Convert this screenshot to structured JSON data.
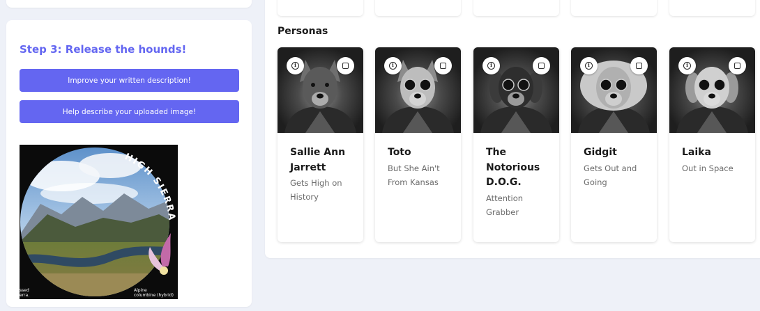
{
  "step": {
    "title": "Step 3: Release the hounds!",
    "buttons": [
      {
        "label": "Improve your written description!"
      },
      {
        "label": "Help describe your uploaded image!"
      }
    ]
  },
  "poster": {
    "arc_text": "HIGH SIERRA",
    "caption_left": "ssed\nerra.",
    "caption_right": "Alpine\ncolumbine (hybrid)"
  },
  "personas": {
    "title": "Personas",
    "cards": [
      {
        "name": "Sallie Ann Jarrett",
        "desc": "Gets High on History"
      },
      {
        "name": "Toto",
        "desc": "But She Ain't From Kansas"
      },
      {
        "name": "The Notorious D.O.G.",
        "desc": "Attention Grabber"
      },
      {
        "name": "Gidgit",
        "desc": "Gets Out and Going"
      },
      {
        "name": "Laika",
        "desc": "Out in Space"
      }
    ]
  },
  "colors": {
    "accent": "#6366f1",
    "button": "#6466f1",
    "background": "#eef1f8"
  },
  "icons": {
    "info": "info-circle-icon",
    "select": "checkbox-icon"
  }
}
